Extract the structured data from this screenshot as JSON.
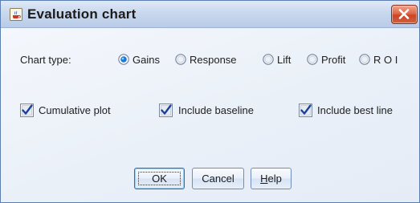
{
  "window": {
    "title": "Evaluation chart",
    "app_icon": "java-cup-icon",
    "close_icon": "close-x-icon"
  },
  "chart_type": {
    "label": "Chart type:",
    "options": [
      {
        "label": "Gains",
        "selected": true
      },
      {
        "label": "Response",
        "selected": false
      },
      {
        "label": "Lift",
        "selected": false
      },
      {
        "label": "Profit",
        "selected": false
      },
      {
        "label": "R O I",
        "selected": false
      }
    ]
  },
  "options": [
    {
      "label": "Cumulative plot",
      "checked": true
    },
    {
      "label": "Include baseline",
      "checked": true
    },
    {
      "label": "Include best line",
      "checked": true
    }
  ],
  "buttons": {
    "ok": "OK",
    "cancel": "Cancel",
    "help_prefix": "H",
    "help_rest": "elp"
  },
  "colors": {
    "radio_selected": "#1f78d8",
    "checkmark": "#1c3f9e",
    "close_button": "#d4603e"
  }
}
